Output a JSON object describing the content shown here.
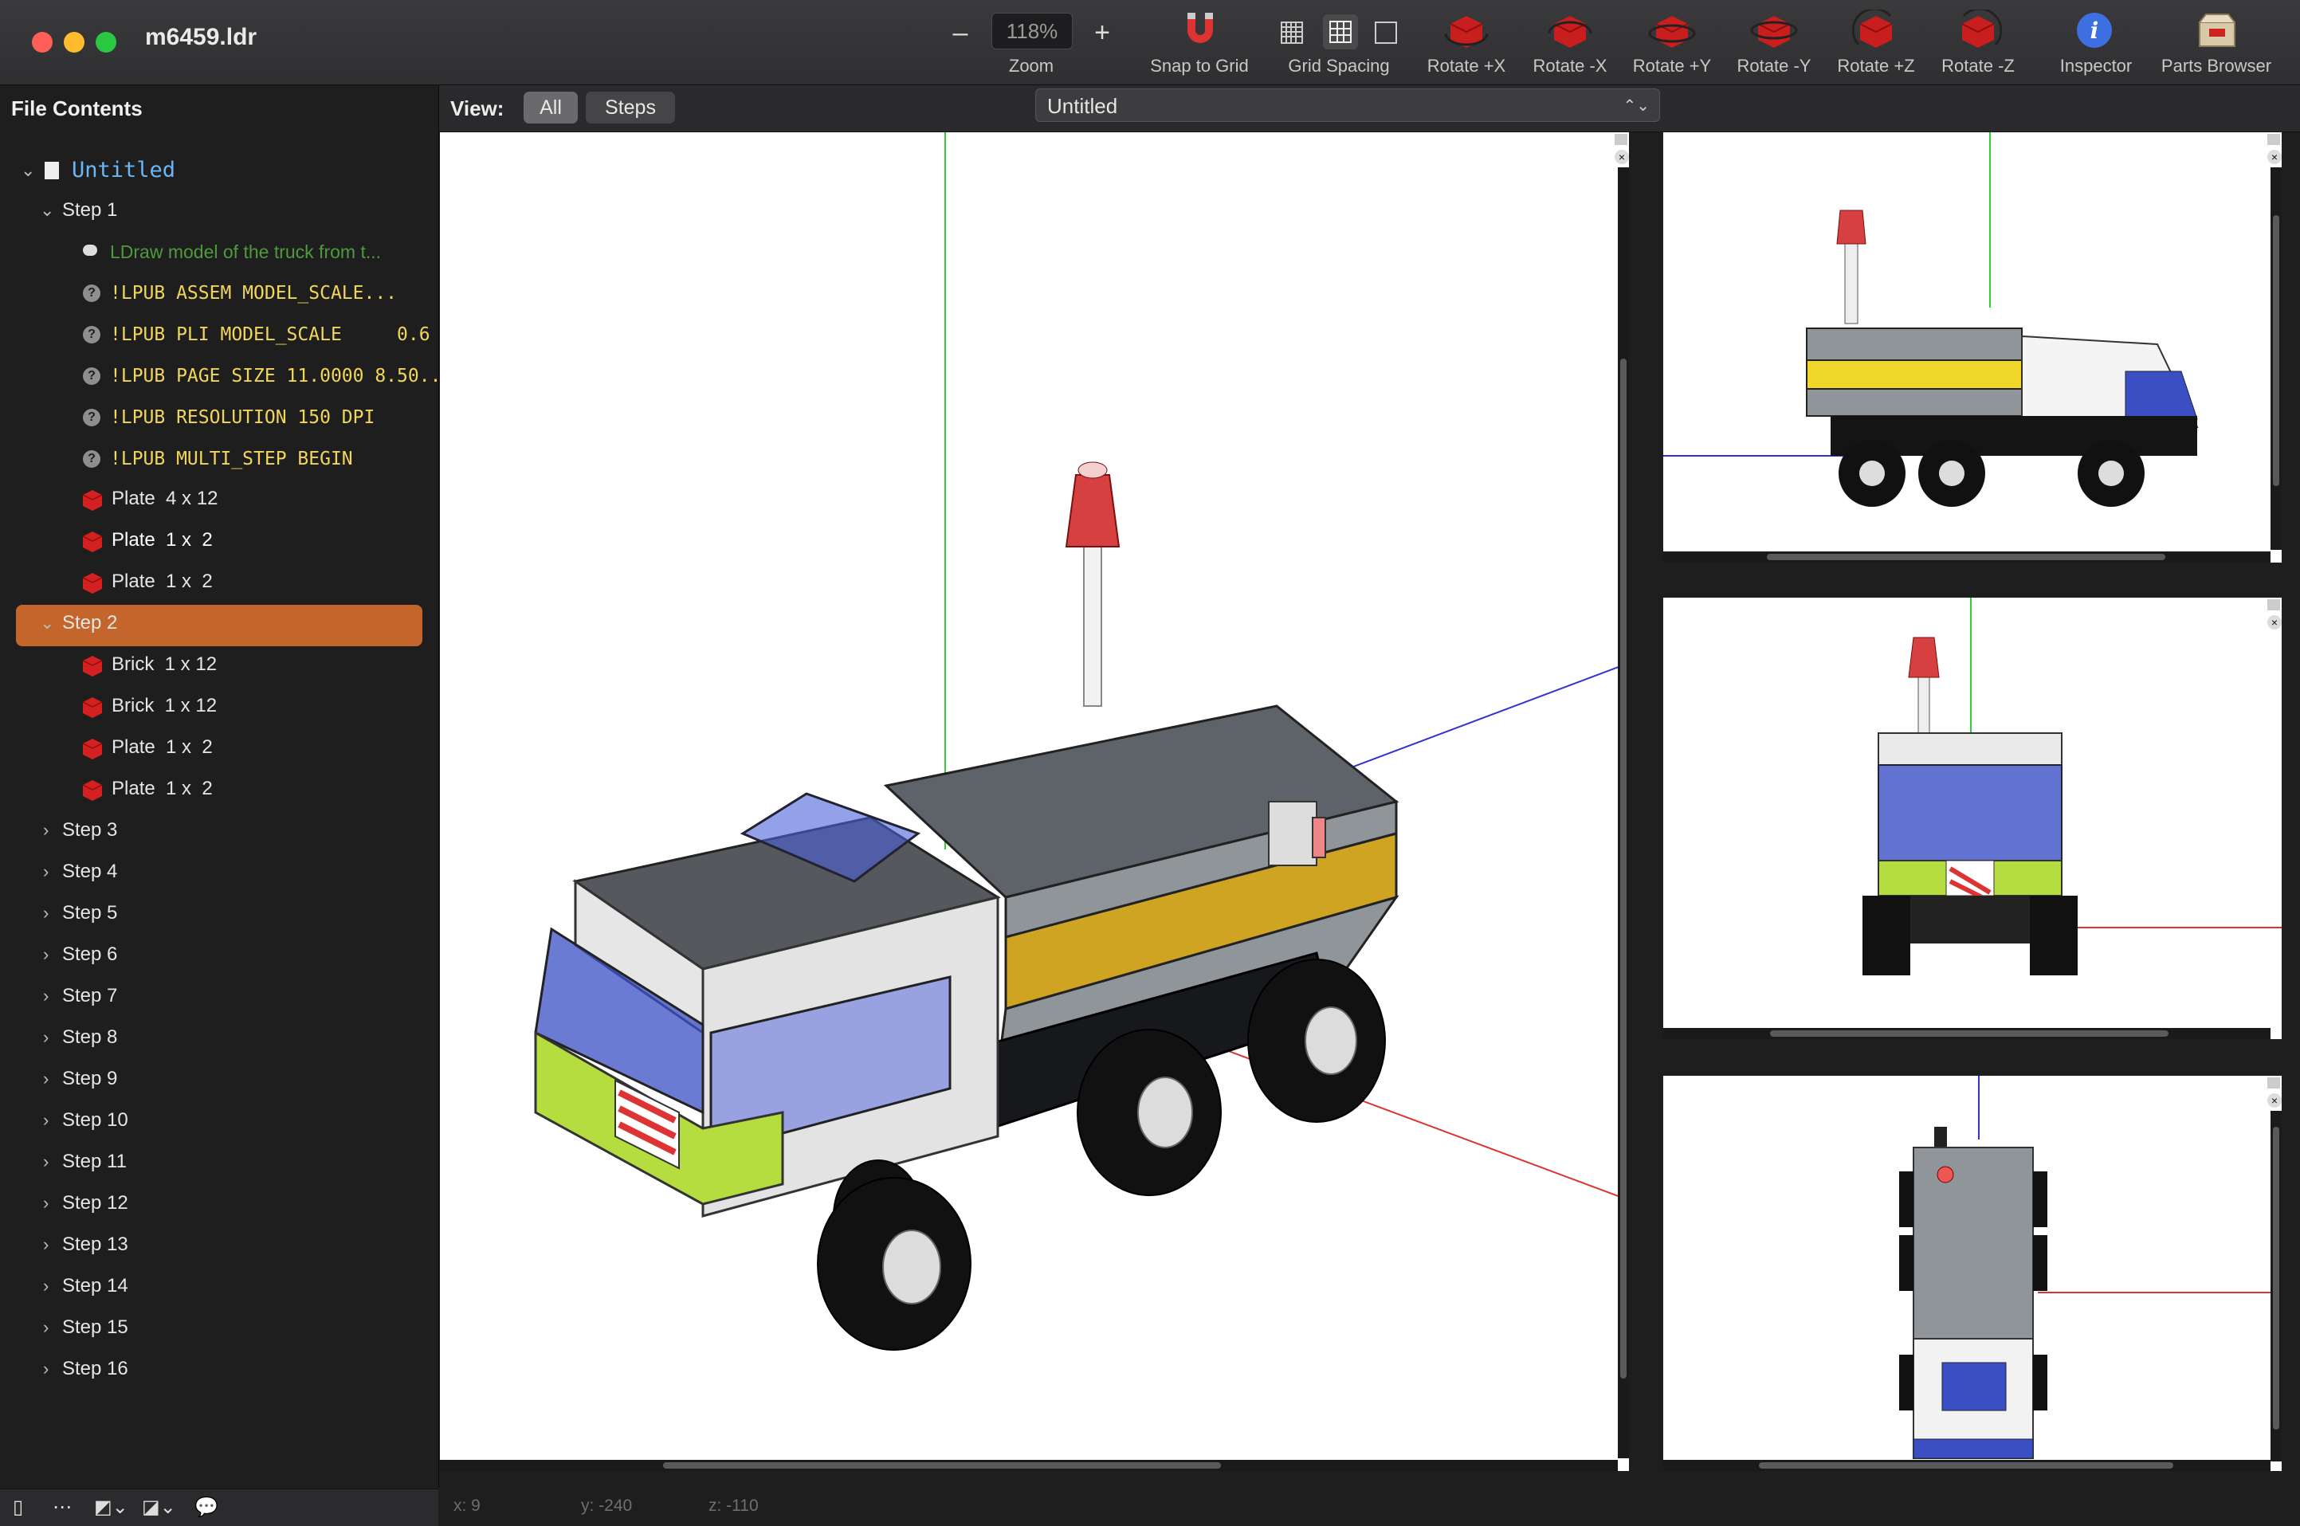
{
  "window": {
    "title": "m6459.ldr"
  },
  "toolbar": {
    "zoom_value": "118%",
    "zoom_minus": "–",
    "zoom_plus": "+",
    "zoom_label": "Zoom",
    "snap_label": "Snap to Grid",
    "grid_spacing_label": "Grid Spacing",
    "rotate_px": "Rotate +X",
    "rotate_mx": "Rotate -X",
    "rotate_py": "Rotate +Y",
    "rotate_my": "Rotate -Y",
    "rotate_pz": "Rotate +Z",
    "rotate_mz": "Rotate -Z",
    "inspector_label": "Inspector",
    "parts_browser_label": "Parts Browser"
  },
  "sidebar": {
    "header": "File Contents",
    "root": "Untitled",
    "step1": "Step 1",
    "comment": "LDraw model of the truck from t...",
    "meta": [
      "!LPUB ASSEM MODEL_SCALE...",
      "!LPUB PLI MODEL_SCALE     0.6",
      "!LPUB PAGE SIZE 11.0000 8.50...",
      "!LPUB RESOLUTION 150 DPI",
      "!LPUB MULTI_STEP BEGIN"
    ],
    "step1_parts": [
      "Plate  4 x 12",
      "Plate  1 x  2",
      "Plate  1 x  2"
    ],
    "step2": "Step 2",
    "step2_parts": [
      "Brick  1 x 12",
      "Brick  1 x 12",
      "Plate  1 x  2",
      "Plate  1 x  2"
    ],
    "collapsed_steps": [
      "Step 3",
      "Step 4",
      "Step 5",
      "Step 6",
      "Step 7",
      "Step 8",
      "Step 9",
      "Step 10",
      "Step 11",
      "Step 12",
      "Step 13",
      "Step 14",
      "Step 15",
      "Step 16"
    ]
  },
  "viewbar": {
    "label": "View:",
    "all": "All",
    "steps": "Steps",
    "model": "Untitled"
  },
  "status": {
    "x": "x: 9",
    "y": "y: -240",
    "z": "z: -110"
  },
  "colors": {
    "selection": "#c4652b",
    "meta_text": "#f2d65c",
    "comment_text": "#4f9a3c",
    "root_text": "#6cb6f5",
    "brick_red": "#d42020"
  }
}
